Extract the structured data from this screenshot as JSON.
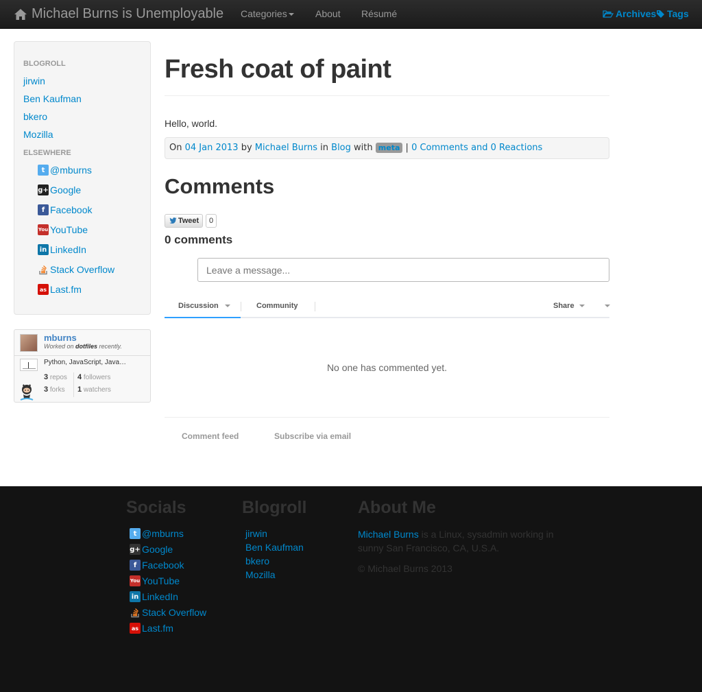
{
  "navbar": {
    "brand": "Michael Burns is Unemployable",
    "categories": "Categories",
    "about": "About",
    "resume": "Résumé",
    "archives": "Archives",
    "tags": "Tags"
  },
  "sidebar": {
    "blogroll_header": "BLOGROLL",
    "blogroll": [
      "jirwin",
      "Ben Kaufman",
      "bkero",
      "Mozilla"
    ],
    "elsewhere_header": "ELSEWHERE",
    "elsewhere": [
      {
        "label": "@mburns",
        "icon": "twitter-icon"
      },
      {
        "label": "Google",
        "icon": "google-plus-icon"
      },
      {
        "label": "Facebook",
        "icon": "facebook-icon"
      },
      {
        "label": "YouTube",
        "icon": "youtube-icon"
      },
      {
        "label": "LinkedIn",
        "icon": "linkedin-icon"
      },
      {
        "label": "Stack Overflow",
        "icon": "stack-overflow-icon"
      },
      {
        "label": "Last.fm",
        "icon": "lastfm-icon"
      }
    ]
  },
  "github": {
    "user": "mburns",
    "note_prefix": "Worked on ",
    "note_repo": "dotfiles",
    "note_suffix": " recently.",
    "languages": "Python, JavaScript, Java…",
    "repos_count": "3",
    "repos_label": "repos",
    "followers_count": "4",
    "followers_label": "followers",
    "forks_count": "3",
    "forks_label": "forks",
    "watchers_count": "1",
    "watchers_label": "watchers"
  },
  "post": {
    "title": "Fresh coat of paint",
    "body": "Hello, world.",
    "meta_on": "On",
    "date": "04 Jan 2013",
    "meta_by": "by",
    "author": "Michael Burns",
    "meta_in": "in",
    "category": "Blog",
    "meta_with": "with",
    "tag": "meta",
    "meta_sep": "|",
    "comments_link": "0 Comments and 0 Reactions"
  },
  "comments": {
    "heading": "Comments",
    "tweet_label": "Tweet",
    "tweet_count": "0",
    "count_title": "0 comments",
    "placeholder": "Leave a message...",
    "tab_discussion": "Discussion",
    "tab_community": "Community",
    "share": "Share",
    "empty": "No one has commented yet.",
    "comment_feed": "Comment feed",
    "subscribe": "Subscribe via email"
  },
  "footer": {
    "socials_heading": "Socials",
    "blogroll_heading": "Blogroll",
    "about_heading": "About Me",
    "about_name": "Michael Burns",
    "about_line1": " is a Linux, sysadmin working in",
    "about_line2": "sunny San Francisco, CA, U.S.A.",
    "copyright": "© Michael Burns 2013"
  },
  "colors": {
    "link": "#0088cc",
    "navbar": "#1b1b1b",
    "footer": "#131313",
    "disqus_active": "#2e9fff"
  }
}
